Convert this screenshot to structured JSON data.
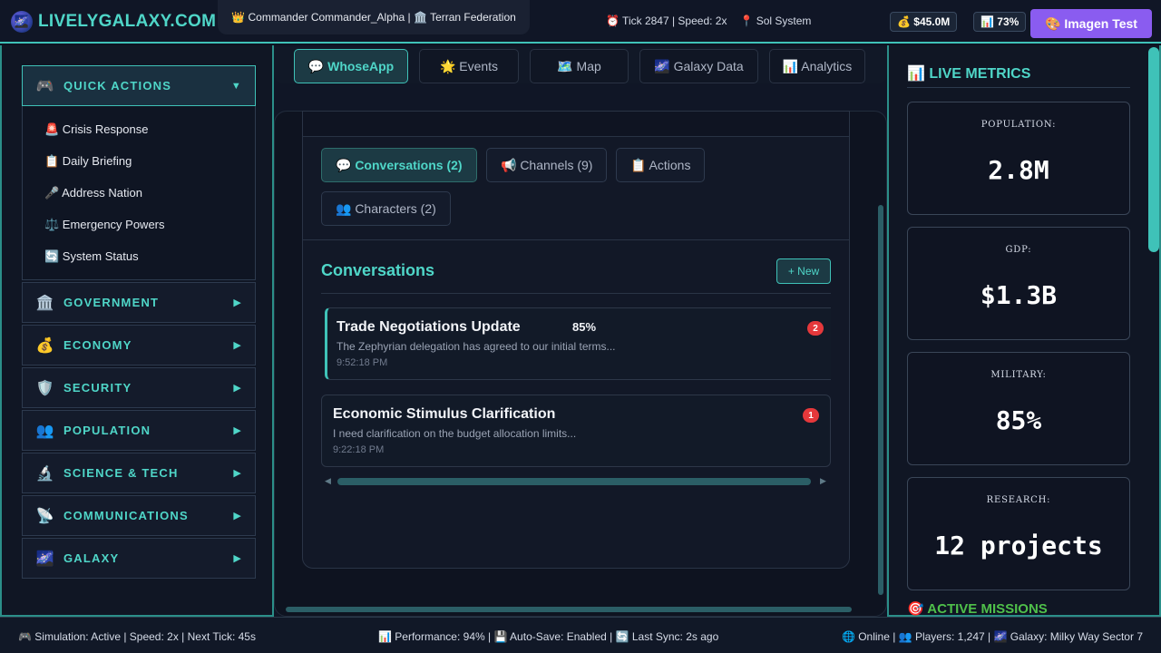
{
  "header": {
    "logo_icon": "🌌",
    "logo_text": "LIVELYGALAXY.COM",
    "commander_label": "👑 Commander Commander_Alpha | 🏛️ Terran Federation",
    "tick_label": "⏰ Tick 2847 | Speed: 2x",
    "location_label": "📍 Sol System",
    "money_label": "💰 $45.0M",
    "performance_label": "📊 73%",
    "imagen_button": "🎨 Imagen Test"
  },
  "sidebar": {
    "sections": [
      {
        "icon": "🎮",
        "label": "QUICK ACTIONS",
        "arrow": "▼",
        "open": true
      },
      {
        "icon": "🏛️",
        "label": "GOVERNMENT",
        "arrow": "▶"
      },
      {
        "icon": "💰",
        "label": "ECONOMY",
        "arrow": "▶"
      },
      {
        "icon": "🛡️",
        "label": "SECURITY",
        "arrow": "▶"
      },
      {
        "icon": "👥",
        "label": "POPULATION",
        "arrow": "▶"
      },
      {
        "icon": "🔬",
        "label": "SCIENCE & TECH",
        "arrow": "▶"
      },
      {
        "icon": "📡",
        "label": "COMMUNICATIONS",
        "arrow": "▶"
      },
      {
        "icon": "🌌",
        "label": "GALAXY",
        "arrow": "▶"
      }
    ],
    "quick_actions": [
      "🚨 Crisis Response",
      "📋 Daily Briefing",
      "🎤 Address Nation",
      "⚖️ Emergency Powers",
      "🔄 System Status"
    ]
  },
  "nav_tabs": [
    "💬 WhoseApp",
    "🌟 Events",
    "🗺️ Map",
    "🌌 Galaxy Data",
    "📊 Analytics"
  ],
  "whoseapp": {
    "tabs": [
      "💬 Conversations (2)",
      "📢 Channels (9)",
      "📋 Actions",
      "👥 Characters (2)"
    ],
    "section_title": "Conversations",
    "new_button": "+ New",
    "conversations": [
      {
        "title": "Trade Negotiations Update",
        "overlay_pct": "85%",
        "preview": "The Zephyrian delegation has agreed to our initial terms...",
        "time": "9:52:18 PM",
        "unread": "2"
      },
      {
        "title": "Economic Stimulus Clarification",
        "preview": "I need clarification on the budget allocation limits...",
        "time": "9:22:18 PM",
        "unread": "1"
      }
    ],
    "scroll_left": "◀",
    "scroll_right": "▶"
  },
  "metrics": {
    "title": "📊 LIVE METRICS",
    "items": [
      {
        "label": "POPULATION:",
        "value": "2.8M"
      },
      {
        "label": "GDP:",
        "value": "$1.3B"
      },
      {
        "label": "MILITARY:",
        "value": "85%"
      },
      {
        "label": "RESEARCH:",
        "value": "12 projects"
      }
    ],
    "missions_title": "🎯 ACTIVE MISSIONS"
  },
  "status_bar": {
    "left": "🎮 Simulation: Active | Speed: 2x | Next Tick: 45s",
    "middle": "📊 Performance: 94% | 💾 Auto-Save: Enabled | 🔄 Last Sync: 2s ago",
    "right": "🌐 Online | 👥 Players: 1,247 | 🌌 Galaxy: Milky Way Sector 7"
  },
  "colors": {
    "accent": "#4fd6c8",
    "background": "#0e1322",
    "imagen_button": "#8a5cf0",
    "badge": "#e5383b",
    "missions": "#4fc04a"
  }
}
